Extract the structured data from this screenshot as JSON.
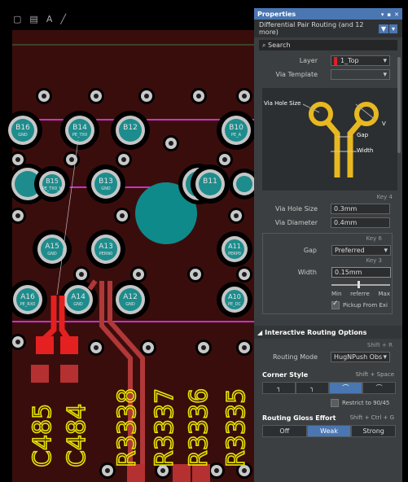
{
  "toolbar": {
    "icons": [
      "square-icon",
      "bar-icon",
      "text-icon",
      "line-icon"
    ],
    "text_tool": "A"
  },
  "pcb": {
    "colors": {
      "board": "#3a0d0d",
      "copper": "#9c2b2b",
      "pad": "#c6c6c6",
      "pad_core": "#1e8c8c",
      "silk": "#e5e500",
      "highlight": "#e02222",
      "magenta": "#c830c8"
    },
    "pads": [
      {
        "line1": "B16",
        "line2": "GND"
      },
      {
        "line1": "B14",
        "line2": "PE_TX0"
      },
      {
        "line1": "B12",
        "line2": ""
      },
      {
        "line1": "B10",
        "line2": "PE_A"
      },
      {
        "line1": "B15",
        "line2": "PE_TX0_N"
      },
      {
        "line1": "B13",
        "line2": "GND"
      },
      {
        "line1": "B11",
        "line2": ""
      },
      {
        "line1": "A15",
        "line2": "GND"
      },
      {
        "line1": "A13",
        "line2": "PERN0"
      },
      {
        "line1": "A11",
        "line2": "PERP0"
      },
      {
        "line1": "A16",
        "line2": "PE_RX0"
      },
      {
        "line1": "A14",
        "line2": "GND"
      },
      {
        "line1": "A12",
        "line2": "GND"
      },
      {
        "line1": "A10",
        "line2": "PE_DC"
      }
    ],
    "silkscreen": [
      "C485",
      "C484",
      "R3338",
      "R3337",
      "R3336",
      "R3335"
    ]
  },
  "panel": {
    "title": "Properties",
    "title_controls": [
      "▾",
      "▪",
      "✕"
    ],
    "mode": "Differential Pair Routing",
    "more": "(and 12 more)",
    "search_placeholder": "Search",
    "layer_label": "Layer",
    "layer_value": "1_Top",
    "layer_color": "#e02020",
    "via_template_label": "Via Template",
    "diagram": {
      "via_hole": "Via Hole Size",
      "gap": "Gap",
      "width": "Width",
      "v": "V"
    },
    "key4": "Key 4",
    "via_hole_label": "Via Hole Size",
    "via_hole_value": "0.3mm",
    "via_diam_label": "Via Diameter",
    "via_diam_value": "0.4mm",
    "key6": "Key 6",
    "gap_label": "Gap",
    "gap_value": "Preferred",
    "key3": "Key 3",
    "width_label": "Width",
    "width_value": "0.15mm",
    "slider_level": 0.46,
    "scale": [
      "Min",
      "referre",
      "Max"
    ],
    "pickup": "Pickup From Exi",
    "pickup_checked": true,
    "iro_title": "Interactive Routing Options",
    "shortcut_r": "Shift + R",
    "routing_mode_label": "Routing Mode",
    "routing_mode_value": "HugNPush Obs",
    "corner_style_label": "Corner Style",
    "corner_shortcut": "Shift + Space",
    "corner_icons": [
      "┐",
      "╮",
      "⌒",
      "⌒"
    ],
    "restrict": "Restrict to 90/45",
    "gloss_label": "Routing Gloss Effort",
    "gloss_shortcut": "Shift + Ctrl + G",
    "gloss_options": [
      "Off",
      "Weak",
      "Strong"
    ],
    "gloss_selected": "Weak"
  }
}
